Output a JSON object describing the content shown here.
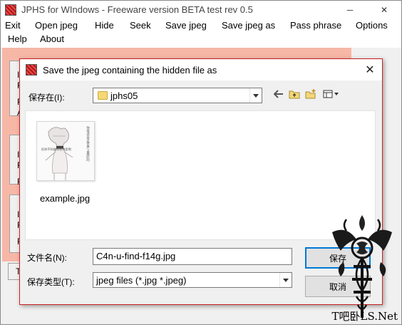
{
  "window": {
    "title": "JPHS for WIndows - Freeware version BETA test rev 0.5",
    "minimize": "─",
    "close": "✕"
  },
  "menu": {
    "items": [
      "Exit",
      "Open jpeg",
      "Hide",
      "Seek",
      "Save jpeg",
      "Save jpeg as",
      "Pass phrase",
      "Options",
      "Help",
      "About"
    ]
  },
  "background_letters": {
    "box1": [
      "I",
      "F",
      "F",
      "A"
    ],
    "box2": [
      "I",
      "F",
      "F"
    ],
    "box3": [
      "I",
      "F",
      "F"
    ],
    "tail": "T"
  },
  "dialog": {
    "title": "Save the jpeg containing the hidden file as",
    "close": "✕",
    "save_in_label": "保存在(I):",
    "save_in_value": "jphs05",
    "toolbar_icons": [
      "back-arrow-icon",
      "up-folder-icon",
      "new-folder-icon",
      "view-menu-icon"
    ],
    "files": [
      {
        "name": "example.jpg",
        "thumb_text_a": "你很适合这世界上最好的",
        "thumb_text_b": "但你不知道你在哪里啊"
      }
    ],
    "filename_label": "文件名(N):",
    "filename_value": "C4n-u-find-f14g.jpg",
    "filetype_label": "保存类型(T):",
    "filetype_value": "jpeg files (*.jpg *.jpeg)",
    "save_button": "保存",
    "cancel_button": "取消"
  },
  "watermark": {
    "text": "T吧卧LS.Net"
  }
}
